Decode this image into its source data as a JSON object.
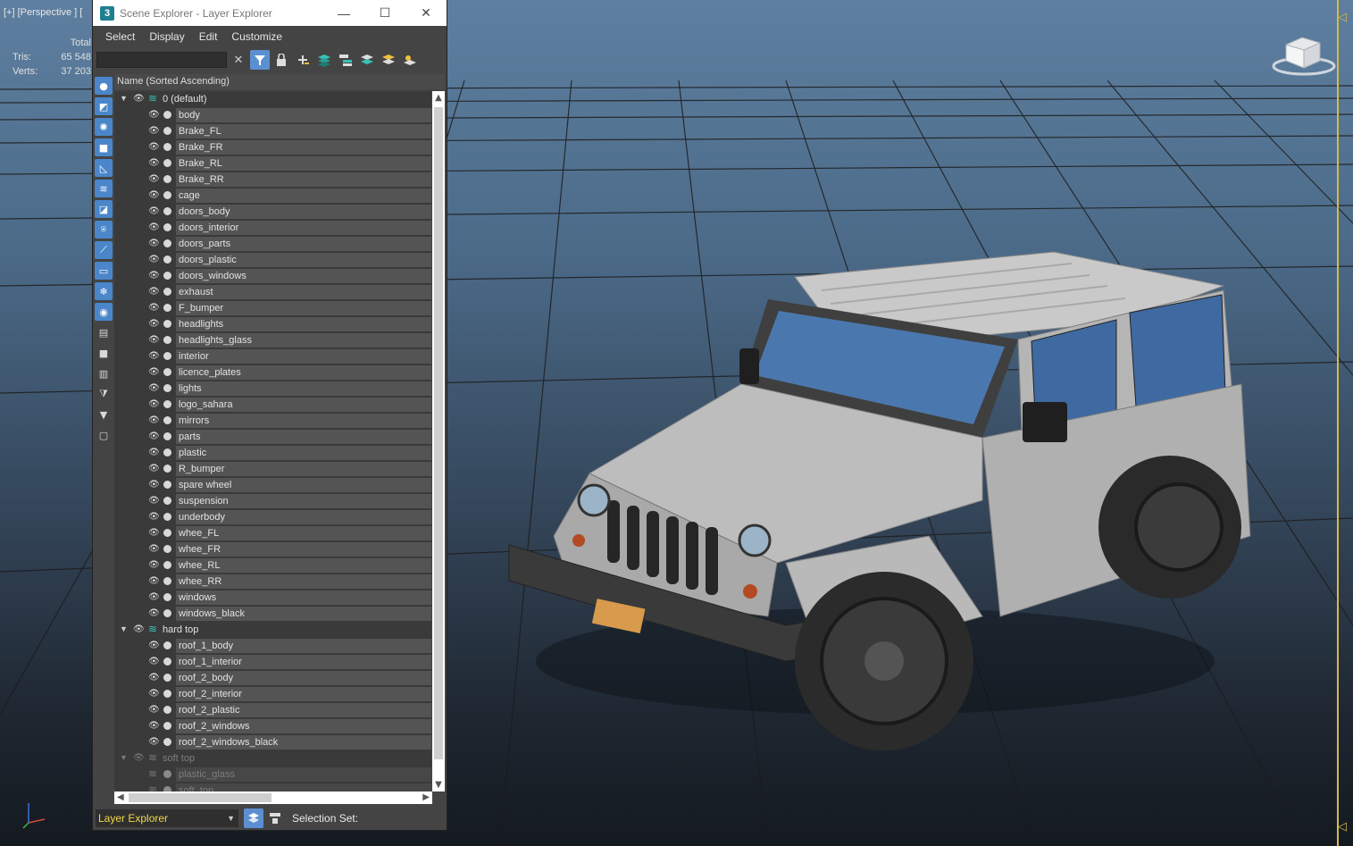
{
  "viewport": {
    "label": "[+] [Perspective ] [",
    "stats": {
      "header": "Total",
      "rows": [
        {
          "key": "Tris:",
          "value": "65 548"
        },
        {
          "key": "Verts:",
          "value": "37 203"
        }
      ]
    },
    "accent_color": "#d7b84b"
  },
  "window": {
    "app_icon": "3",
    "title": "Scene Explorer - Layer Explorer",
    "buttons": {
      "minimize": "—",
      "maximize": "☐",
      "close": "✕"
    }
  },
  "menu": [
    "Select",
    "Display",
    "Edit",
    "Customize"
  ],
  "search": {
    "value": "",
    "clear": "✕"
  },
  "tree": {
    "header": "Name (Sorted Ascending)",
    "rows": [
      {
        "type": "layer",
        "label": "0 (default)",
        "dim": false
      },
      {
        "type": "object",
        "label": "body",
        "dim": false
      },
      {
        "type": "object",
        "label": "Brake_FL",
        "dim": false
      },
      {
        "type": "object",
        "label": "Brake_FR",
        "dim": false
      },
      {
        "type": "object",
        "label": "Brake_RL",
        "dim": false
      },
      {
        "type": "object",
        "label": "Brake_RR",
        "dim": false
      },
      {
        "type": "object",
        "label": "cage",
        "dim": false
      },
      {
        "type": "object",
        "label": "doors_body",
        "dim": false
      },
      {
        "type": "object",
        "label": "doors_interior",
        "dim": false
      },
      {
        "type": "object",
        "label": "doors_parts",
        "dim": false
      },
      {
        "type": "object",
        "label": "doors_plastic",
        "dim": false
      },
      {
        "type": "object",
        "label": "doors_windows",
        "dim": false
      },
      {
        "type": "object",
        "label": "exhaust",
        "dim": false
      },
      {
        "type": "object",
        "label": "F_bumper",
        "dim": false
      },
      {
        "type": "object",
        "label": "headlights",
        "dim": false
      },
      {
        "type": "object",
        "label": "headlights_glass",
        "dim": false
      },
      {
        "type": "object",
        "label": "interior",
        "dim": false
      },
      {
        "type": "object",
        "label": "licence_plates",
        "dim": false
      },
      {
        "type": "object",
        "label": "lights",
        "dim": false
      },
      {
        "type": "object",
        "label": "logo_sahara",
        "dim": false
      },
      {
        "type": "object",
        "label": "mirrors",
        "dim": false
      },
      {
        "type": "object",
        "label": "parts",
        "dim": false
      },
      {
        "type": "object",
        "label": "plastic",
        "dim": false
      },
      {
        "type": "object",
        "label": "R_bumper",
        "dim": false
      },
      {
        "type": "object",
        "label": "spare wheel",
        "dim": false
      },
      {
        "type": "object",
        "label": "suspension",
        "dim": false
      },
      {
        "type": "object",
        "label": "underbody",
        "dim": false
      },
      {
        "type": "object",
        "label": "whee_FL",
        "dim": false
      },
      {
        "type": "object",
        "label": "whee_FR",
        "dim": false
      },
      {
        "type": "object",
        "label": "whee_RL",
        "dim": false
      },
      {
        "type": "object",
        "label": "whee_RR",
        "dim": false
      },
      {
        "type": "object",
        "label": "windows",
        "dim": false
      },
      {
        "type": "object",
        "label": "windows_black",
        "dim": false
      },
      {
        "type": "layer",
        "label": "hard top",
        "dim": false
      },
      {
        "type": "object",
        "label": "roof_1_body",
        "dim": false
      },
      {
        "type": "object",
        "label": "roof_1_interior",
        "dim": false
      },
      {
        "type": "object",
        "label": "roof_2_body",
        "dim": false
      },
      {
        "type": "object",
        "label": "roof_2_interior",
        "dim": false
      },
      {
        "type": "object",
        "label": "roof_2_plastic",
        "dim": false
      },
      {
        "type": "object",
        "label": "roof_2_windows",
        "dim": false
      },
      {
        "type": "object",
        "label": "roof_2_windows_black",
        "dim": false
      },
      {
        "type": "layer",
        "label": "soft top",
        "dim": true
      },
      {
        "type": "object",
        "label": "plastic_glass",
        "dim": true
      },
      {
        "type": "object",
        "label": "soft_top",
        "dim": true
      }
    ]
  },
  "bottom": {
    "explorer_select": "Layer Explorer",
    "selection_set_label": "Selection Set:"
  },
  "colors": {
    "active_blue": "#5b8fd1",
    "layer_teal": "#37c2b6",
    "select_yellow": "#f0d84a"
  }
}
